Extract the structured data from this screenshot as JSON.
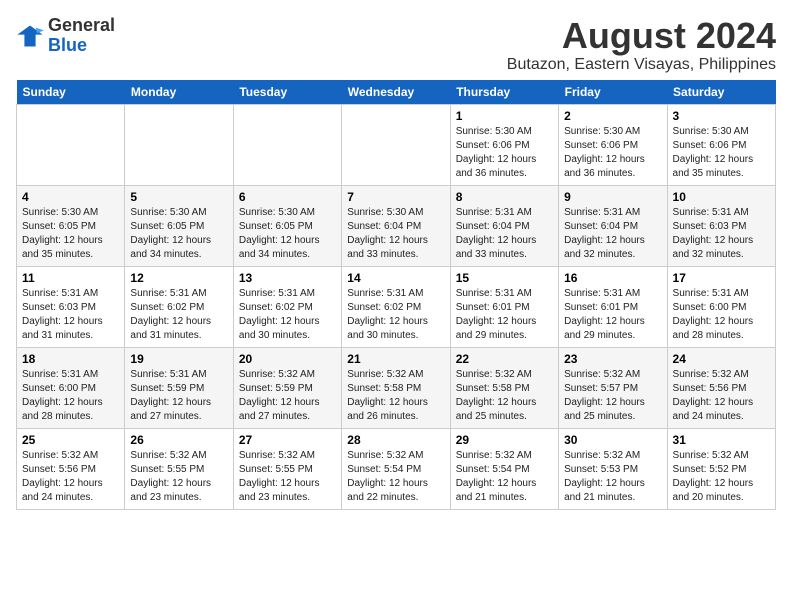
{
  "header": {
    "logo_line1": "General",
    "logo_line2": "Blue",
    "title": "August 2024",
    "subtitle": "Butazon, Eastern Visayas, Philippines"
  },
  "days_of_week": [
    "Sunday",
    "Monday",
    "Tuesday",
    "Wednesday",
    "Thursday",
    "Friday",
    "Saturday"
  ],
  "weeks": [
    [
      {
        "day": "",
        "info": ""
      },
      {
        "day": "",
        "info": ""
      },
      {
        "day": "",
        "info": ""
      },
      {
        "day": "",
        "info": ""
      },
      {
        "day": "1",
        "info": "Sunrise: 5:30 AM\nSunset: 6:06 PM\nDaylight: 12 hours\nand 36 minutes."
      },
      {
        "day": "2",
        "info": "Sunrise: 5:30 AM\nSunset: 6:06 PM\nDaylight: 12 hours\nand 36 minutes."
      },
      {
        "day": "3",
        "info": "Sunrise: 5:30 AM\nSunset: 6:06 PM\nDaylight: 12 hours\nand 35 minutes."
      }
    ],
    [
      {
        "day": "4",
        "info": "Sunrise: 5:30 AM\nSunset: 6:05 PM\nDaylight: 12 hours\nand 35 minutes."
      },
      {
        "day": "5",
        "info": "Sunrise: 5:30 AM\nSunset: 6:05 PM\nDaylight: 12 hours\nand 34 minutes."
      },
      {
        "day": "6",
        "info": "Sunrise: 5:30 AM\nSunset: 6:05 PM\nDaylight: 12 hours\nand 34 minutes."
      },
      {
        "day": "7",
        "info": "Sunrise: 5:30 AM\nSunset: 6:04 PM\nDaylight: 12 hours\nand 33 minutes."
      },
      {
        "day": "8",
        "info": "Sunrise: 5:31 AM\nSunset: 6:04 PM\nDaylight: 12 hours\nand 33 minutes."
      },
      {
        "day": "9",
        "info": "Sunrise: 5:31 AM\nSunset: 6:04 PM\nDaylight: 12 hours\nand 32 minutes."
      },
      {
        "day": "10",
        "info": "Sunrise: 5:31 AM\nSunset: 6:03 PM\nDaylight: 12 hours\nand 32 minutes."
      }
    ],
    [
      {
        "day": "11",
        "info": "Sunrise: 5:31 AM\nSunset: 6:03 PM\nDaylight: 12 hours\nand 31 minutes."
      },
      {
        "day": "12",
        "info": "Sunrise: 5:31 AM\nSunset: 6:02 PM\nDaylight: 12 hours\nand 31 minutes."
      },
      {
        "day": "13",
        "info": "Sunrise: 5:31 AM\nSunset: 6:02 PM\nDaylight: 12 hours\nand 30 minutes."
      },
      {
        "day": "14",
        "info": "Sunrise: 5:31 AM\nSunset: 6:02 PM\nDaylight: 12 hours\nand 30 minutes."
      },
      {
        "day": "15",
        "info": "Sunrise: 5:31 AM\nSunset: 6:01 PM\nDaylight: 12 hours\nand 29 minutes."
      },
      {
        "day": "16",
        "info": "Sunrise: 5:31 AM\nSunset: 6:01 PM\nDaylight: 12 hours\nand 29 minutes."
      },
      {
        "day": "17",
        "info": "Sunrise: 5:31 AM\nSunset: 6:00 PM\nDaylight: 12 hours\nand 28 minutes."
      }
    ],
    [
      {
        "day": "18",
        "info": "Sunrise: 5:31 AM\nSunset: 6:00 PM\nDaylight: 12 hours\nand 28 minutes."
      },
      {
        "day": "19",
        "info": "Sunrise: 5:31 AM\nSunset: 5:59 PM\nDaylight: 12 hours\nand 27 minutes."
      },
      {
        "day": "20",
        "info": "Sunrise: 5:32 AM\nSunset: 5:59 PM\nDaylight: 12 hours\nand 27 minutes."
      },
      {
        "day": "21",
        "info": "Sunrise: 5:32 AM\nSunset: 5:58 PM\nDaylight: 12 hours\nand 26 minutes."
      },
      {
        "day": "22",
        "info": "Sunrise: 5:32 AM\nSunset: 5:58 PM\nDaylight: 12 hours\nand 25 minutes."
      },
      {
        "day": "23",
        "info": "Sunrise: 5:32 AM\nSunset: 5:57 PM\nDaylight: 12 hours\nand 25 minutes."
      },
      {
        "day": "24",
        "info": "Sunrise: 5:32 AM\nSunset: 5:56 PM\nDaylight: 12 hours\nand 24 minutes."
      }
    ],
    [
      {
        "day": "25",
        "info": "Sunrise: 5:32 AM\nSunset: 5:56 PM\nDaylight: 12 hours\nand 24 minutes."
      },
      {
        "day": "26",
        "info": "Sunrise: 5:32 AM\nSunset: 5:55 PM\nDaylight: 12 hours\nand 23 minutes."
      },
      {
        "day": "27",
        "info": "Sunrise: 5:32 AM\nSunset: 5:55 PM\nDaylight: 12 hours\nand 23 minutes."
      },
      {
        "day": "28",
        "info": "Sunrise: 5:32 AM\nSunset: 5:54 PM\nDaylight: 12 hours\nand 22 minutes."
      },
      {
        "day": "29",
        "info": "Sunrise: 5:32 AM\nSunset: 5:54 PM\nDaylight: 12 hours\nand 21 minutes."
      },
      {
        "day": "30",
        "info": "Sunrise: 5:32 AM\nSunset: 5:53 PM\nDaylight: 12 hours\nand 21 minutes."
      },
      {
        "day": "31",
        "info": "Sunrise: 5:32 AM\nSunset: 5:52 PM\nDaylight: 12 hours\nand 20 minutes."
      }
    ]
  ]
}
